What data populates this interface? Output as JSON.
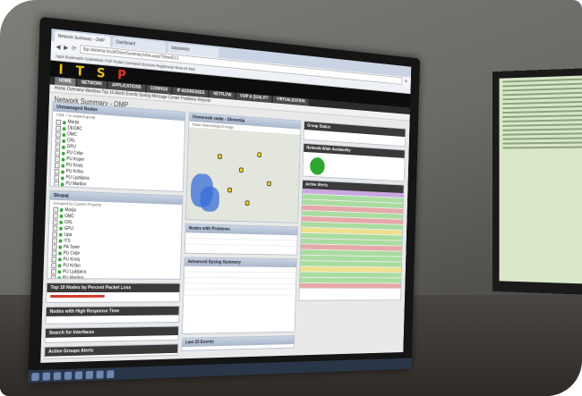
{
  "browser": {
    "tabs": [
      "Network Summary - OMP",
      "Dashboard",
      "Solarwinds"
    ],
    "url": "itsp.domena.local/Orion/SummaryView.aspx?ViewID=1",
    "bookmarks": "Apps  Bookmarks  SolarWinds  ITSP Portal  Command Structure  Registracija  Nova 24 Mail"
  },
  "app": {
    "logo_left": "I T S",
    "logo_right": "P",
    "menu": [
      "HOME",
      "NETWORK",
      "APPLICATIONS",
      "CONFIGS",
      "IP ADDRESSES",
      "NETFLOW",
      "VOIP & QUALITY",
      "VIRTUALIZATION"
    ],
    "submenu": "Home  Overview  Wireless  Top 10  Alerts  Events  Syslog  Message Center  Problems  Reports",
    "page_title": "Network Summary - OMP"
  },
  "panels": {
    "nodes_title": "Unmanaged Nodes",
    "nodes_sub": "Click + to expand group",
    "nodes": [
      "Marija",
      "DEOAC",
      "OMC",
      "CRL",
      "GPU",
      "PU Celje",
      "PU Koper",
      "PU Kranj",
      "PU Krško",
      "PU Ljubljana",
      "PU Maribor",
      "PU Murska Sobota",
      "PU Nova Gorica",
      "PU Novo mesto",
      "PU Ptuj",
      "PU Slovenj Gradec",
      "Rezerva",
      "TEST"
    ],
    "sites_title": "Skupaj",
    "sites_sub": "Grouped by Custom Property",
    "sites": [
      "Marija",
      "OMC",
      "CRL",
      "GPU",
      "Lipa",
      "ITS",
      "PA Taxer",
      "PU Celje",
      "PU Kranj",
      "PU Krško",
      "PU Ljubljana",
      "PU Maribor",
      "PU Murska Sobota",
      "PU Nova Gorica",
      "PU Novo mesto",
      "PU Ptuj",
      "PU Slovenj Gradec",
      "Vodstvo"
    ],
    "top10_title": "Top 10 Nodes by Percent Packet Loss",
    "response_title": "Nodes with High Response Time",
    "search_title": "Search for Interfaces",
    "alerts_title": "Active Groups Alerts",
    "map_title": "Vremenski radar - Slovenija",
    "map_sub": "Radar Meteorological Image",
    "events_title": "Nodes with Problems",
    "syslog_title": "Advanced Syslog Summary",
    "last_events_title": "Last 25 Events",
    "status_title": "Group Status",
    "mod_title": "Network-Wide Availability",
    "all_events_title": "Active Alerts"
  }
}
